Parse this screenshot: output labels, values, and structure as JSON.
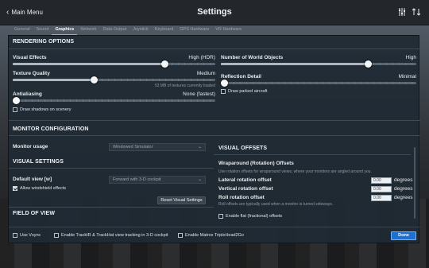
{
  "window": {
    "back_label": "Main Menu",
    "title": "Settings",
    "icons": [
      "sliders-icon",
      "dual-arrow-icon"
    ]
  },
  "tabs": [
    {
      "label": "General",
      "active": false
    },
    {
      "label": "Sound",
      "active": false
    },
    {
      "label": "Graphics",
      "active": true
    },
    {
      "label": "Network",
      "active": false
    },
    {
      "label": "Data Output",
      "active": false
    },
    {
      "label": "Joystick",
      "active": false
    },
    {
      "label": "Keyboard",
      "active": false
    },
    {
      "label": "GPS Hardware",
      "active": false
    },
    {
      "label": "VR Hardware",
      "active": false
    }
  ],
  "rendering": {
    "title": "RENDERING OPTIONS",
    "visual_effects": {
      "label": "Visual Effects",
      "value": "High (HDR)",
      "level": 0.75
    },
    "texture_quality": {
      "label": "Texture Quality",
      "value": "Medium",
      "level": 0.4,
      "note": "53 MB of textures currently loaded"
    },
    "antialiasing": {
      "label": "Antialiasing",
      "value": "None (fastest)",
      "level": 0.0
    },
    "draw_shadows": {
      "label": "Draw shadows on scenery",
      "checked": false
    },
    "world_objects": {
      "label": "Number of World Objects",
      "value": "High",
      "level": 0.75
    },
    "reflection_detail": {
      "label": "Reflection Detail",
      "value": "Minimal",
      "level": 0.0
    },
    "draw_parked": {
      "label": "Draw parked aircraft",
      "checked": false
    }
  },
  "monitor": {
    "title": "MONITOR CONFIGURATION",
    "usage_label": "Monitor usage",
    "usage_value": "Windowed Simulator"
  },
  "visual_settings": {
    "title": "VISUAL SETTINGS",
    "default_view_label": "Default view [w]",
    "default_view_value": "Forward with 3-D cockpit",
    "windshield": {
      "label": "Allow windshield effects",
      "checked": true
    },
    "reset_button": "Reset Visual Settings"
  },
  "field_of_view": {
    "title": "FIELD OF VIEW"
  },
  "visual_offsets": {
    "title": "VISUAL OFFSETS",
    "subtitle": "Wraparound (Rotation) Offsets",
    "description": "Use rotation offsets for wraparound views, where your monitors are angled around you.",
    "lateral": {
      "label": "Lateral rotation offset",
      "value": "0.00",
      "unit": "degrees"
    },
    "vertical": {
      "label": "Vertical rotation offset",
      "value": "0.00",
      "unit": "degrees"
    },
    "roll": {
      "label": "Roll rotation offset",
      "value": "0.00",
      "unit": "degrees",
      "note": "Roll offsets are typically used when a monitor is turned sideways."
    },
    "flat_offsets": {
      "label": "Enable flat (fractional) offsets",
      "checked": false
    }
  },
  "bottom": {
    "vsync": {
      "label": "Use Vsync",
      "checked": false
    },
    "trackir": {
      "label": "Enable TrackIR & TrackHat view tracking in 3-D cockpit",
      "checked": false
    },
    "matrox": {
      "label": "Enable Matrox TripleHead2Go",
      "checked": false
    },
    "done_button": "Done"
  }
}
